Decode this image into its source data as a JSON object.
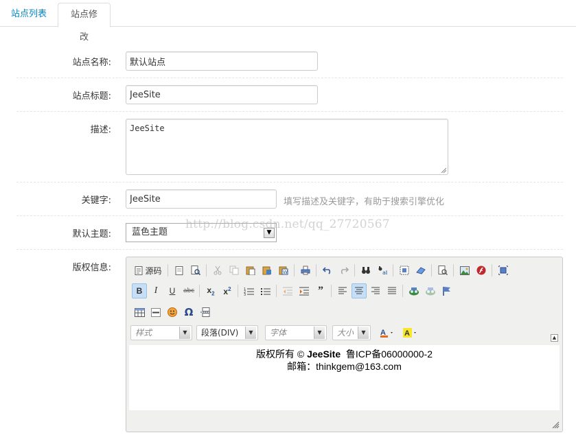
{
  "tabs": {
    "list": "站点列表",
    "edit": "站点修改"
  },
  "form": {
    "name_label": "站点名称:",
    "name_value": "默认站点",
    "title_label": "站点标题:",
    "title_value": "JeeSite",
    "desc_label": "描述:",
    "desc_value": "JeeSite",
    "keywords_label": "关键字:",
    "keywords_value": "JeeSite",
    "keywords_help": "填写描述及关键字，有助于搜索引擎优化",
    "theme_label": "默认主题:",
    "theme_value": "蓝色主题",
    "copyright_label": "版权信息:"
  },
  "watermark": "http://blog.csdn.net/qq_27720567",
  "editor": {
    "source_label": "源码",
    "style_placeholder": "样式",
    "format_value": "段落(DIV)",
    "font_placeholder": "字体",
    "size_placeholder": "大小",
    "content_line1_prefix": "版权所有 © ",
    "content_line1_bold": "JeeSite",
    "content_line1_suffix": "  鲁ICP备06000000-2",
    "content_line2": "邮箱：thinkgem@163.com"
  },
  "colors": {
    "link": "#0088cc",
    "pressed": "#c6dff6"
  }
}
